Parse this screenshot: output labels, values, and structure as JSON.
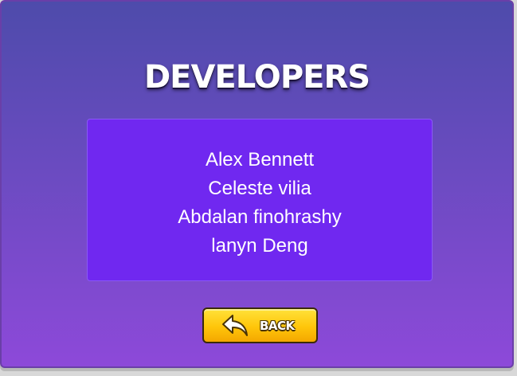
{
  "screen": {
    "title": "DEVELOPERS"
  },
  "developers": {
    "names": [
      "Alex Bennett",
      "Celeste vilia",
      "Abdalan finohrashy",
      "lanyn Deng"
    ]
  },
  "back_button": {
    "label": "BACK",
    "icon": "back-arrow-icon"
  },
  "colors": {
    "background_top": "#4e4bab",
    "background_bottom": "#8d49d9",
    "panel": "#7028f0",
    "button": "#ffc50a"
  }
}
